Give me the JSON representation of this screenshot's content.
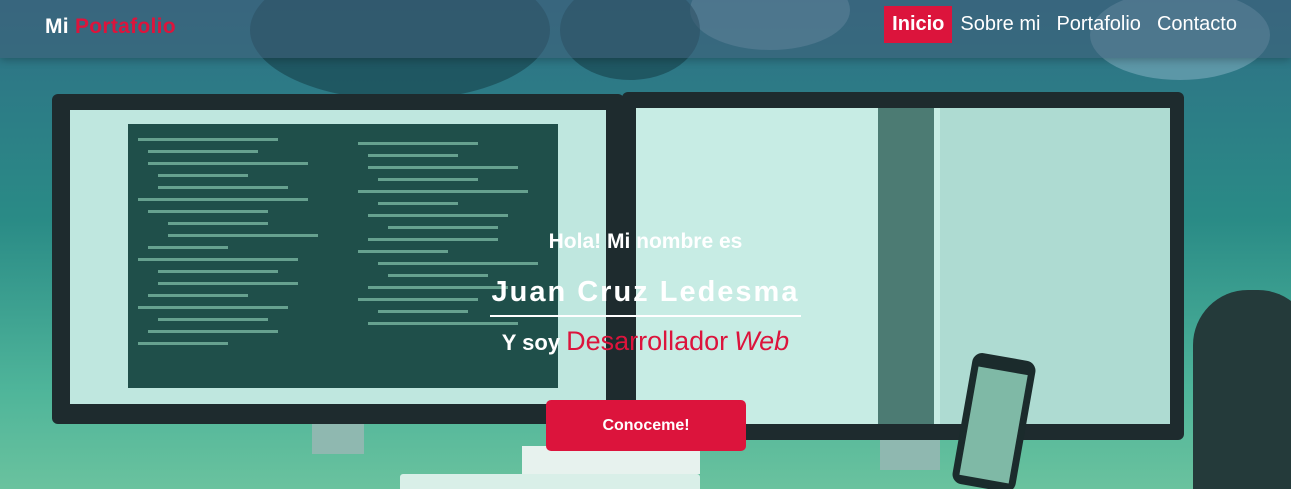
{
  "navbar": {
    "brand_prefix": "Mi",
    "brand_highlight": "Portafolio",
    "items": [
      {
        "label": "Inicio",
        "active": true
      },
      {
        "label": "Sobre mi",
        "active": false
      },
      {
        "label": "Portafolio",
        "active": false
      },
      {
        "label": "Contacto",
        "active": false
      }
    ]
  },
  "hero": {
    "greeting": "Hola! Mi nombre es",
    "name": "Juan Cruz Ledesma",
    "role_prefix": "Y soy",
    "role_title": "Desarrollador",
    "role_title_emphasis": "Web",
    "cta_label": "Conoceme!"
  },
  "colors": {
    "accent": "#dc143c",
    "text": "#ffffff"
  }
}
